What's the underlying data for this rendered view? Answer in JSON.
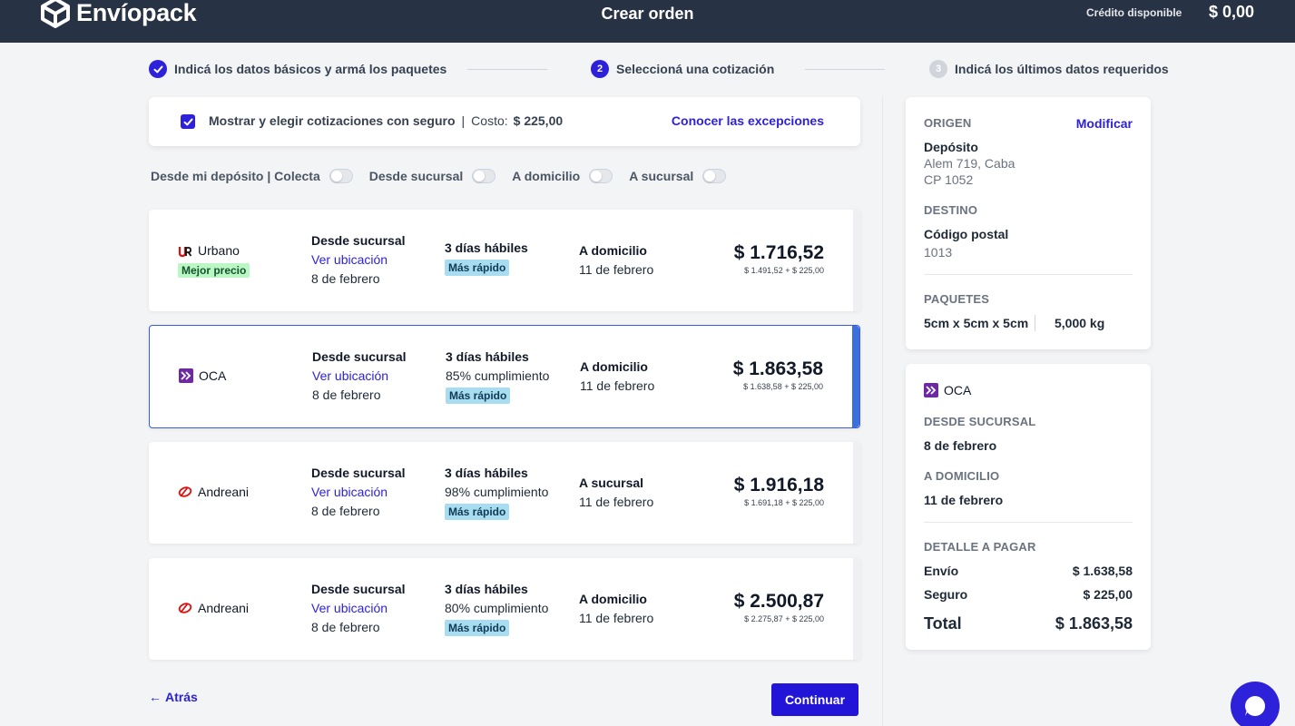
{
  "header": {
    "brand": "Envíopack",
    "title": "Crear orden",
    "credit_label": "Crédito disponible",
    "credit_value": "$ 0,00"
  },
  "stepper": [
    {
      "label": "Indicá los datos básicos y armá los paquetes",
      "number": "✓",
      "state": "done"
    },
    {
      "label": "Seleccioná una cotización",
      "number": "2",
      "state": "active"
    },
    {
      "label": "Indicá los últimos datos requeridos",
      "number": "3",
      "state": "pending"
    }
  ],
  "insurance": {
    "label": "Mostrar y elegir cotizaciones con seguro",
    "separator": "|",
    "cost_label": "Costo:",
    "cost_value": "$ 225,00",
    "link": "Conocer las excepciones",
    "checked": true
  },
  "filters": [
    {
      "label": "Desde mi depósito | Colecta",
      "on": false
    },
    {
      "label": "Desde sucursal",
      "on": false
    },
    {
      "label": "A domicilio",
      "on": false
    },
    {
      "label": "A sucursal",
      "on": false
    }
  ],
  "quotes": [
    {
      "carrier": "Urbano",
      "badge": "Mejor precio",
      "origin_type": "Desde sucursal",
      "origin_link": "Ver ubicación",
      "origin_date": "8 de febrero",
      "days": "3 días hábiles",
      "compliance": "",
      "fast": "Más rápido",
      "dest_type": "A domicilio",
      "dest_date": "11 de febrero",
      "price": "$ 1.716,52",
      "breakdown": "$ 1.491,52 + $ 225,00"
    },
    {
      "carrier": "OCA",
      "badge": "",
      "origin_type": "Desde sucursal",
      "origin_link": "Ver ubicación",
      "origin_date": "8 de febrero",
      "days": "3 días hábiles",
      "compliance": "85% cumplimiento",
      "fast": "Más rápido",
      "dest_type": "A domicilio",
      "dest_date": "11 de febrero",
      "price": "$ 1.863,58",
      "breakdown": "$ 1.638,58 + $ 225,00"
    },
    {
      "carrier": "Andreani",
      "badge": "",
      "origin_type": "Desde sucursal",
      "origin_link": "Ver ubicación",
      "origin_date": "8 de febrero",
      "days": "3 días hábiles",
      "compliance": "98% cumplimiento",
      "fast": "Más rápido",
      "dest_type": "A sucursal",
      "dest_date": "11 de febrero",
      "price": "$ 1.916,18",
      "breakdown": "$ 1.691,18 + $ 225,00"
    },
    {
      "carrier": "Andreani",
      "badge": "",
      "origin_type": "Desde sucursal",
      "origin_link": "Ver ubicación",
      "origin_date": "8 de febrero",
      "days": "3 días hábiles",
      "compliance": "80% cumplimiento",
      "fast": "Más rápido",
      "dest_type": "A domicilio",
      "dest_date": "11 de febrero",
      "price": "$ 2.500,87",
      "breakdown": "$ 2.275,87 + $ 225,00"
    }
  ],
  "actions": {
    "back": "Atrás",
    "back_arrow": "←",
    "continue": "Continuar"
  },
  "summary": {
    "origin_head": "ORIGEN",
    "modify": "Modificar",
    "origin_name": "Depósito",
    "origin_address": "Alem 719, Caba",
    "origin_cp": "CP 1052",
    "dest_head": "DESTINO",
    "dest_name": "Código postal",
    "dest_cp": "1013",
    "packages_head": "PAQUETES",
    "package_dims": "5cm x 5cm x 5cm",
    "package_weight": "5,000 kg"
  },
  "selected": {
    "carrier": "OCA",
    "origin_head": "DESDE SUCURSAL",
    "origin_date": "8 de febrero",
    "dest_head": "A DOMICILIO",
    "dest_date": "11 de febrero",
    "detail_head": "DETALLE A PAGAR",
    "shipping_label": "Envío",
    "shipping_value": "$ 1.638,58",
    "insurance_label": "Seguro",
    "insurance_value": "$ 225,00",
    "total_label": "Total",
    "total_value": "$ 1.863,58"
  },
  "colors": {
    "header_bg": "#273344",
    "accent": "#2d22d9",
    "selected_border": "#3b5bdb",
    "best_price_bg": "#bbf7c5",
    "fast_bg": "#a8dcf0"
  }
}
